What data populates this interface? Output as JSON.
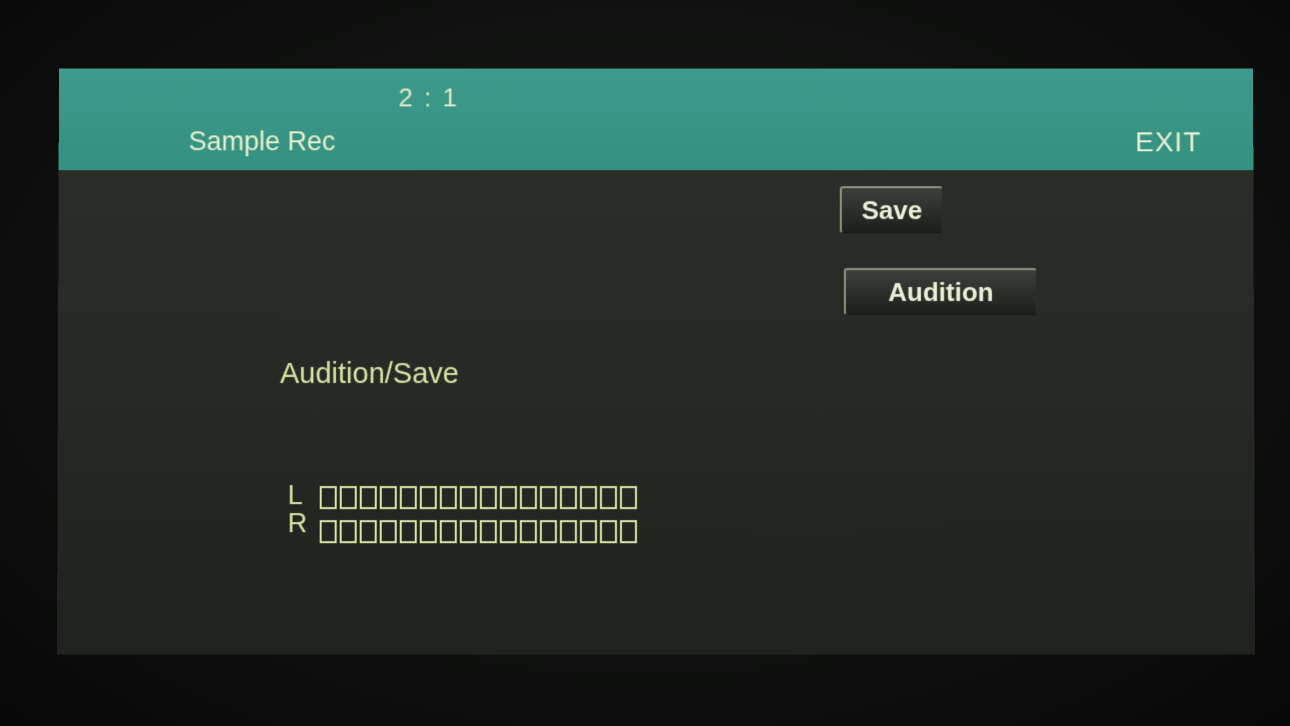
{
  "header": {
    "position": "2 : 1",
    "title": "Sample Rec",
    "exit_label": "EXIT"
  },
  "buttons": {
    "save_label": "Save",
    "audition_label": "Audition"
  },
  "main": {
    "status_label": "Audition/Save"
  },
  "meters": {
    "left_label": "L",
    "right_label": "R",
    "left_level": 0,
    "right_level": 0,
    "segments": 16
  },
  "colors": {
    "header_bg": "#3e9a8a",
    "screen_bg": "#2b2e29",
    "text_accent": "#d7e6a8"
  }
}
